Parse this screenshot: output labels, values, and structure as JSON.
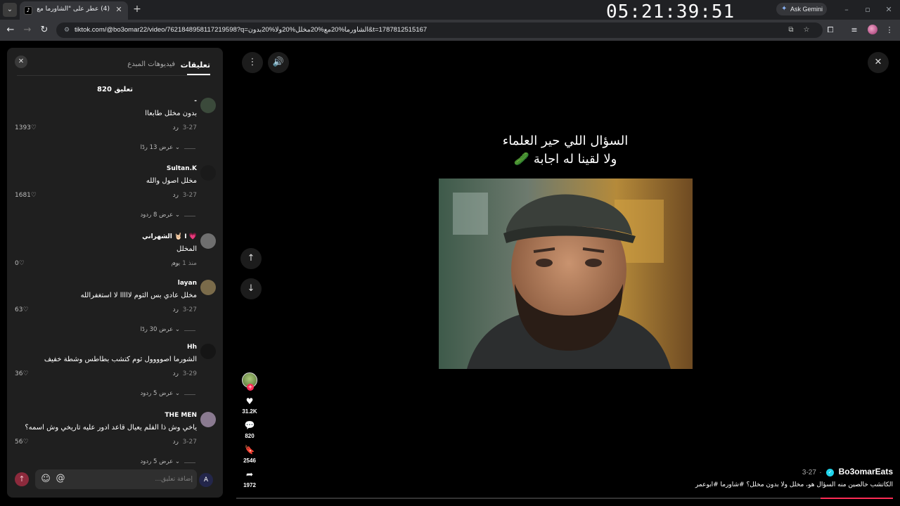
{
  "browser": {
    "tab_title": "(4) عطر على \"الشاورما مع مخل...",
    "tab_favicon": "tiktok-logo",
    "new_tab": "+",
    "clock": "05:21:39:51",
    "ask_gemini": "Ask Gemini",
    "url": "tiktok.com/@bo3omar22/video/7621848958117219598?q=الشاورما%20مع%20مخلل%20ولا%20بدون&t=1787812515167"
  },
  "comments_panel": {
    "tab_comments": "تعليقات",
    "tab_creator_videos": "فيديوهات المبدع",
    "count_label": "820 تعليق",
    "reply_label": "رد",
    "comments": [
      {
        "user": "-",
        "text": "بدون مخلل طابعاا",
        "date": "3-27",
        "likes": "1393",
        "replies": "عرض 13 ردًا",
        "avatar_color": "#3b4a3b"
      },
      {
        "user": "Sultan.K",
        "text": "مخلل اصول والله",
        "date": "3-27",
        "likes": "1681",
        "replies": "عرض 8 ردود",
        "avatar_color": "#1a1a1a"
      },
      {
        "user": "الشهراني 🤘🏻 I 💗",
        "text": "المخلل",
        "date": "منذ 1 يوم",
        "likes": "0",
        "replies": "",
        "avatar_color": "#6f6f6f"
      },
      {
        "user": "layan",
        "text": "مخلل عادي بس الثوم لااااا لا استغفرالله",
        "date": "3-27",
        "likes": "63",
        "replies": "عرض 30 ردًا",
        "avatar_color": "#7a6b4a"
      },
      {
        "user": "Hh",
        "text": "الشورما اصوووول ثوم كتشب بطاطس وشطة خفيف",
        "date": "3-29",
        "likes": "36",
        "replies": "عرض 5 ردود",
        "avatar_color": "#151515"
      },
      {
        "user": "THE MEN",
        "text": "ياخي وش ذا الفلم يعيال قاعد ادور عليه تاريخي وش اسمه؟",
        "date": "3-27",
        "likes": "56",
        "replies": "عرض 5 ردود",
        "avatar_color": "#8a7a90"
      }
    ],
    "input_placeholder": "إضافة تعليق..."
  },
  "video": {
    "caption_line1": "السؤال اللي حير العلماء",
    "caption_line2": "ولا لقينا له اجابة 🥒",
    "likes": "31.2K",
    "comments": "820",
    "saves": "2546",
    "shares": "1972",
    "creator_name": "Bo3omarEats",
    "post_date": "3-27",
    "description": "الكاتشب خالصين منه السؤال هو، مخلل ولا بدون مخلل؟ #شاورما #ابوعمر",
    "progress": 0.11,
    "accent_color": "#fe2c55"
  }
}
